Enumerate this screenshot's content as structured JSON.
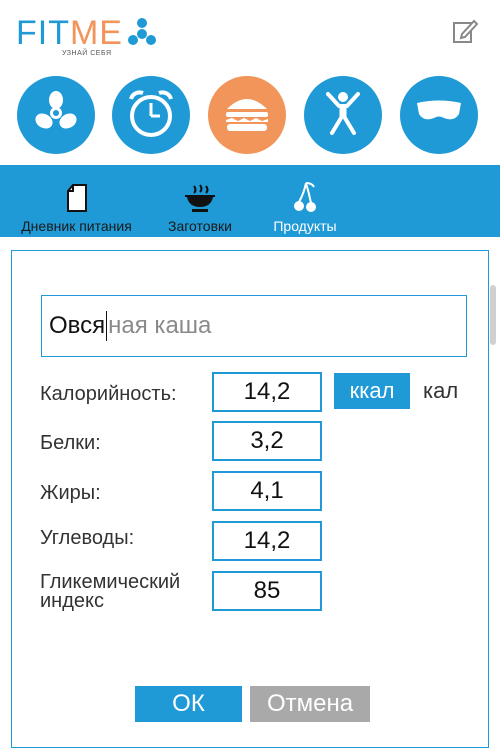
{
  "app": {
    "logo_fit": "FIT",
    "logo_me": "ME",
    "tagline": "УЗНАЙ СЕБЯ",
    "icons": {
      "logo_mark": "fan-logo-icon",
      "edit": "edit-icon",
      "nav": [
        "fan-icon",
        "alarm-clock-icon",
        "burger-icon",
        "jumping-person-icon",
        "sleep-mask-icon"
      ]
    },
    "colors": {
      "accent": "#1f9ad6",
      "active": "#f2955a",
      "cancel": "#a9a9a9"
    }
  },
  "tabs": [
    {
      "label": "Дневник питания",
      "icon": "document-icon"
    },
    {
      "label": "Заготовки",
      "icon": "dish-icon"
    },
    {
      "label": "Продукты",
      "icon": "cherries-icon"
    }
  ],
  "dialog": {
    "name_typed": "Овся",
    "name_placeholder_rest": "ная каша",
    "rows": [
      {
        "label": "Калорийность:",
        "value": "14,2"
      },
      {
        "label": "Белки:",
        "value": "3,2"
      },
      {
        "label": "Жиры:",
        "value": "4,1"
      },
      {
        "label": "Углеводы:",
        "value": "14,2"
      },
      {
        "label_line1": "Гликемический",
        "label_line2": "индекс",
        "value": "85"
      }
    ],
    "unit_selected": "ккал",
    "unit_other": "кал",
    "ok_label": "ОК",
    "cancel_label": "Отмена"
  }
}
